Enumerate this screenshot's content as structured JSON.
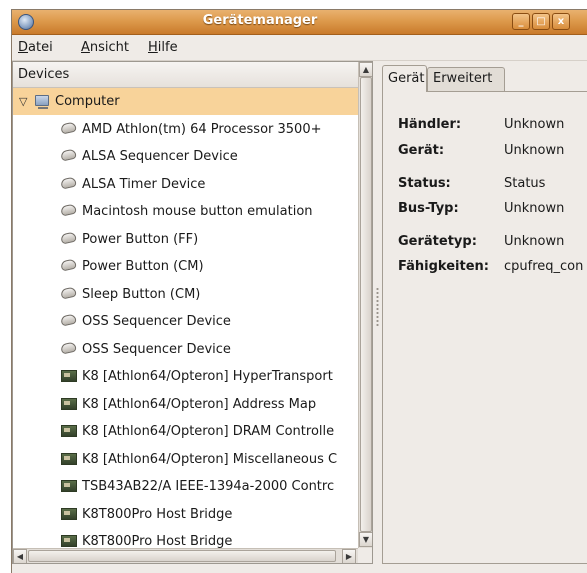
{
  "window": {
    "title": "Gerätemanager"
  },
  "titlebar_buttons": {
    "minimize": "_",
    "maximize": "□",
    "close": "x"
  },
  "menu": [
    {
      "mnemonic": "D",
      "rest": "atei"
    },
    {
      "mnemonic": "A",
      "rest": "nsicht"
    },
    {
      "mnemonic": "H",
      "rest": "ilfe"
    }
  ],
  "tree": {
    "header": "Devices",
    "root": {
      "label": "Computer",
      "expanded": true,
      "selected": true,
      "icon": "computer-icon"
    },
    "items": [
      {
        "label": "AMD Athlon(tm) 64 Processor 3500+",
        "icon": "device-icon"
      },
      {
        "label": "ALSA Sequencer Device",
        "icon": "device-icon"
      },
      {
        "label": "ALSA Timer Device",
        "icon": "device-icon"
      },
      {
        "label": "Macintosh mouse button emulation",
        "icon": "device-icon"
      },
      {
        "label": "Power Button (FF)",
        "icon": "device-icon"
      },
      {
        "label": "Power Button (CM)",
        "icon": "device-icon"
      },
      {
        "label": "Sleep Button (CM)",
        "icon": "device-icon"
      },
      {
        "label": "OSS Sequencer Device",
        "icon": "device-icon"
      },
      {
        "label": "OSS Sequencer Device",
        "icon": "device-icon"
      },
      {
        "label": "K8 [Athlon64/Opteron] HyperTransport",
        "icon": "chip-icon"
      },
      {
        "label": "K8 [Athlon64/Opteron] Address Map",
        "icon": "chip-icon"
      },
      {
        "label": "K8 [Athlon64/Opteron] DRAM Controlle",
        "icon": "chip-icon"
      },
      {
        "label": "K8 [Athlon64/Opteron] Miscellaneous C",
        "icon": "chip-icon"
      },
      {
        "label": "TSB43AB22/A IEEE-1394a-2000 Contrc",
        "icon": "chip-icon"
      },
      {
        "label": "K8T800Pro Host Bridge",
        "icon": "chip-icon"
      },
      {
        "label": "K8T800Pro Host Bridge",
        "icon": "chip-icon"
      }
    ]
  },
  "tabs": [
    {
      "label": "Gerät",
      "active": true
    },
    {
      "label": "Erweitert",
      "active": false
    }
  ],
  "properties": [
    {
      "label": "Händler:",
      "value": "Unknown"
    },
    {
      "label": "Gerät:",
      "value": "Unknown"
    },
    {
      "label": "Status:",
      "value": "Status"
    },
    {
      "label": "Bus-Typ:",
      "value": "Unknown"
    },
    {
      "label": "Gerätetyp:",
      "value": "Unknown"
    },
    {
      "label": "Fähigkeiten:",
      "value": "cpufreq_con"
    }
  ],
  "colors": {
    "titlebar": "#dd9a4c",
    "selection": "#f8d39a",
    "window_bg": "#efebe7"
  }
}
